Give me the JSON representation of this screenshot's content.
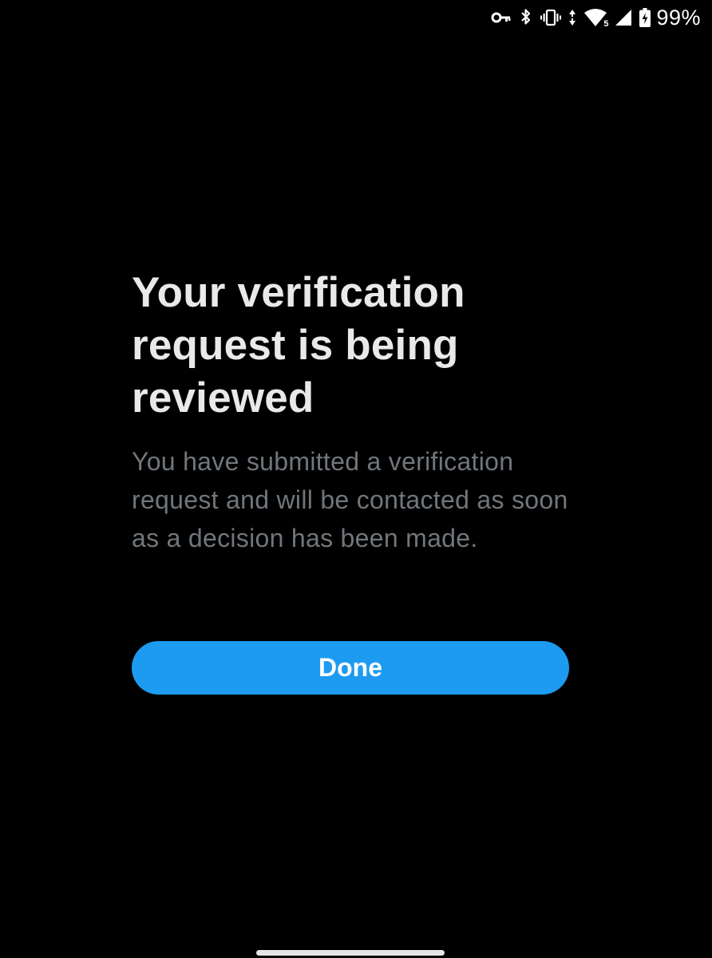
{
  "status_bar": {
    "icons": [
      "vpn-key-icon",
      "bluetooth-icon",
      "vibrate-icon",
      "data-arrows-icon",
      "wifi-icon",
      "cell-signal-icon",
      "battery-charging-icon"
    ],
    "battery_percent": "99%",
    "wifi_badge": "5"
  },
  "main": {
    "title": "Your verification request is being reviewed",
    "subtitle": "You have submitted a verification request and will be contacted as soon as a decision has been made.",
    "done_label": "Done"
  },
  "colors": {
    "background": "#000000",
    "title": "#e7e9ea",
    "subtitle": "#71767b",
    "accent": "#1d9bf0",
    "button_text": "#ffffff"
  }
}
